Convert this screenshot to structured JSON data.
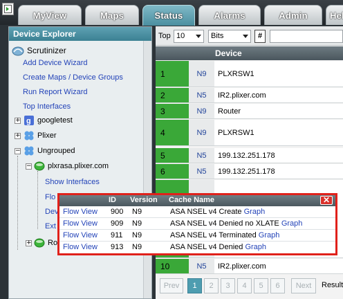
{
  "nav": {
    "tabs": [
      {
        "label": "MyView"
      },
      {
        "label": "Maps"
      },
      {
        "label": "Status"
      },
      {
        "label": "Alarms"
      },
      {
        "label": "Admin"
      },
      {
        "label": "Hel"
      }
    ],
    "active_tab": "Status"
  },
  "explorer": {
    "title": "Device Explorer",
    "root": "Scrutinizer",
    "links": [
      "Add Device Wizard",
      "Create Maps / Device Groups",
      "Run Report Wizard",
      "Top Interfaces"
    ],
    "groups": [
      {
        "label": "googletest",
        "expander": "+",
        "icon": "google-group-icon"
      },
      {
        "label": "Plixer",
        "expander": "+",
        "icon": "group-icon"
      },
      {
        "label": "Ungrouped",
        "expander": "−",
        "icon": "group-icon"
      }
    ],
    "device": {
      "label": "plxrasa.plixer.com",
      "expander": "−",
      "icon": "device-icon"
    },
    "device_links": [
      "Show Interfaces",
      "Flo",
      "Dev",
      "Ext"
    ],
    "partial_node": "Ro"
  },
  "toolbar": {
    "top_label": "Top",
    "top_value": "10",
    "unit_value": "Bits",
    "hash_label": "#"
  },
  "table": {
    "header": "Device",
    "rows": [
      {
        "num": "1",
        "type": "N9",
        "device": "PLXRSW1"
      },
      {
        "num": "2",
        "type": "N5",
        "device": "IR2.plixer.com"
      },
      {
        "num": "3",
        "type": "N9",
        "device": "Router"
      },
      {
        "num": "4",
        "type": "N9",
        "device": "PLXRSW1"
      },
      {
        "num": "5",
        "type": "N5",
        "device": "199.132.251.178"
      },
      {
        "num": "6",
        "type": "N5",
        "device": "199.132.251.178"
      },
      {
        "num": "10",
        "type": "N5",
        "device": "IR2.plixer.com"
      }
    ]
  },
  "pagination": {
    "prev": "Prev",
    "pages": [
      "1",
      "2",
      "3",
      "4",
      "5",
      "6"
    ],
    "current": "1",
    "next": "Next",
    "results": "Results"
  },
  "popup": {
    "columns": [
      "ID",
      "Version",
      "Cache Name"
    ],
    "close": "✕",
    "rows": [
      {
        "action": "Flow View",
        "id": "900",
        "version": "N9",
        "cache": "ASA NSEL v4 Create",
        "link": "Graph"
      },
      {
        "action": "Flow View",
        "id": "909",
        "version": "N9",
        "cache": "ASA NSEL v4 Denied no XLATE",
        "link": "Graph"
      },
      {
        "action": "Flow View",
        "id": "911",
        "version": "N9",
        "cache": "ASA NSEL v4 Terminated",
        "link": "Graph"
      },
      {
        "action": "Flow View",
        "id": "913",
        "version": "N9",
        "cache": "ASA NSEL v4 Denied",
        "link": "Graph"
      }
    ]
  },
  "colors": {
    "accent": "#4e9db0",
    "status_green": "#3aa838",
    "highlight_red": "#e0211b",
    "link_blue": "#2343b8"
  }
}
